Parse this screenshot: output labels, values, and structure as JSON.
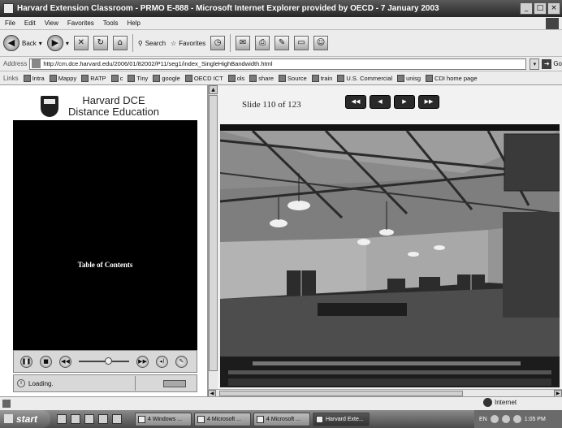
{
  "window": {
    "title": "Harvard Extension Classroom - PRMO E-888 - Microsoft Internet Explorer provided by OECD - 7 January 2003",
    "controls": [
      "_",
      "□",
      "×"
    ]
  },
  "menu": [
    "File",
    "Edit",
    "View",
    "Favorites",
    "Tools",
    "Help"
  ],
  "toolbar": {
    "back": "Back",
    "search": "Search",
    "favorites": "Favorites"
  },
  "address": {
    "label": "Address",
    "url": "http://cm.dce.harvard.edu/2006/01/82002/P11/seg1/index_SingleHighBandwidth.html",
    "go": "Go"
  },
  "links": {
    "label": "Links",
    "items": [
      "Intra",
      "Mappy",
      "RATP",
      "c",
      "Tiny",
      "google",
      "OECD ICT",
      "ols",
      "share",
      "Source",
      "train",
      "U.S. Commercial",
      "unisg",
      "CDI home page"
    ]
  },
  "player": {
    "header_line1": "Harvard DCE",
    "header_line2": "Distance Education",
    "toc_title": "Table of Contents",
    "status": "Loading."
  },
  "slides": {
    "counter": "Slide 110 of 123",
    "nav": [
      "◀◀",
      "◀",
      "▶",
      "▶▶"
    ]
  },
  "statusbar": {
    "zone": "Internet"
  },
  "taskbar": {
    "start": "start",
    "tasks": [
      "4 Windows ...",
      "4 Microsoft ...",
      "4 Microsoft ...",
      "Harvard Exte..."
    ],
    "tray": "EN",
    "clock": "1:05 PM"
  }
}
